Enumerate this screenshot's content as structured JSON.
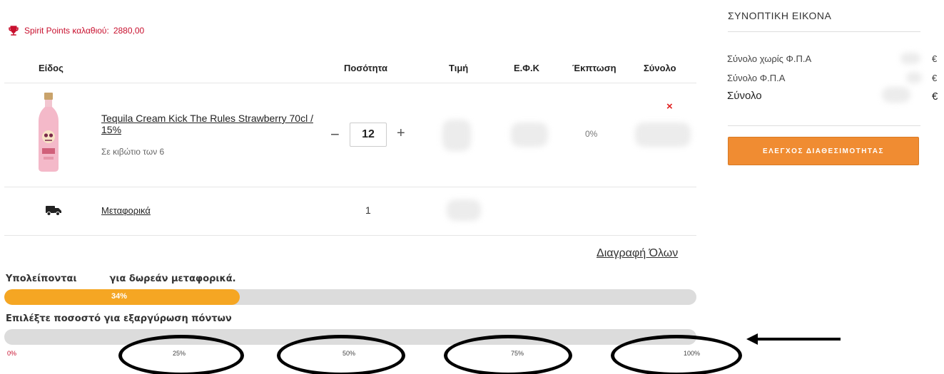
{
  "points": {
    "label": "Spirit Points καλαθιού:",
    "value": "2880,00",
    "icon": "trophy-icon"
  },
  "table": {
    "headers": {
      "item": "Είδος",
      "quantity": "Ποσότητα",
      "price": "Τιμή",
      "excise": "Ε.Φ.Κ",
      "discount": "Έκπτωση",
      "total": "Σύνολο"
    },
    "product": {
      "name": "Tequila Cream Kick The Rules Strawberry 70cl / 15%",
      "box_info": "Σε κιβώτιο των 6",
      "quantity": "12",
      "minus": "−",
      "plus": "+",
      "discount": "0%",
      "remove": "×"
    },
    "shipping": {
      "label": "Μεταφορικά",
      "quantity": "1",
      "icon": "truck-icon"
    }
  },
  "delete_all": "Διαγραφή Όλων",
  "free_shipping": {
    "label_start": "Υπολείπονται",
    "label_end": "για δωρεάν μεταφορικά.",
    "progress_label": "34%",
    "progress": 0.34
  },
  "redeem": {
    "label": "Επιλέξτε ποσοστό για εξαργύρωση πόντων",
    "progress": 0,
    "ticks": [
      "0%",
      "25%",
      "50%",
      "75%",
      "100%"
    ]
  },
  "summary": {
    "title": "ΣΥΝΟΠΤΙΚΗ ΕΙΚΟΝΑ",
    "rows": [
      {
        "label": "Σύνολο χωρίς Φ.Π.Α",
        "currency": "€"
      },
      {
        "label": "Σύνολο Φ.Π.Α",
        "currency": "€"
      },
      {
        "label": "Σύνολο",
        "currency": "€"
      }
    ],
    "button": "ΕΛΕΓΧΟΣ ΔΙΑΘΕΣΙΜΟΤΗΤΑΣ"
  },
  "colors": {
    "accent": "#f08c32",
    "progress": "#f5a623",
    "points": "#c8102e",
    "remove": "#e02020"
  }
}
